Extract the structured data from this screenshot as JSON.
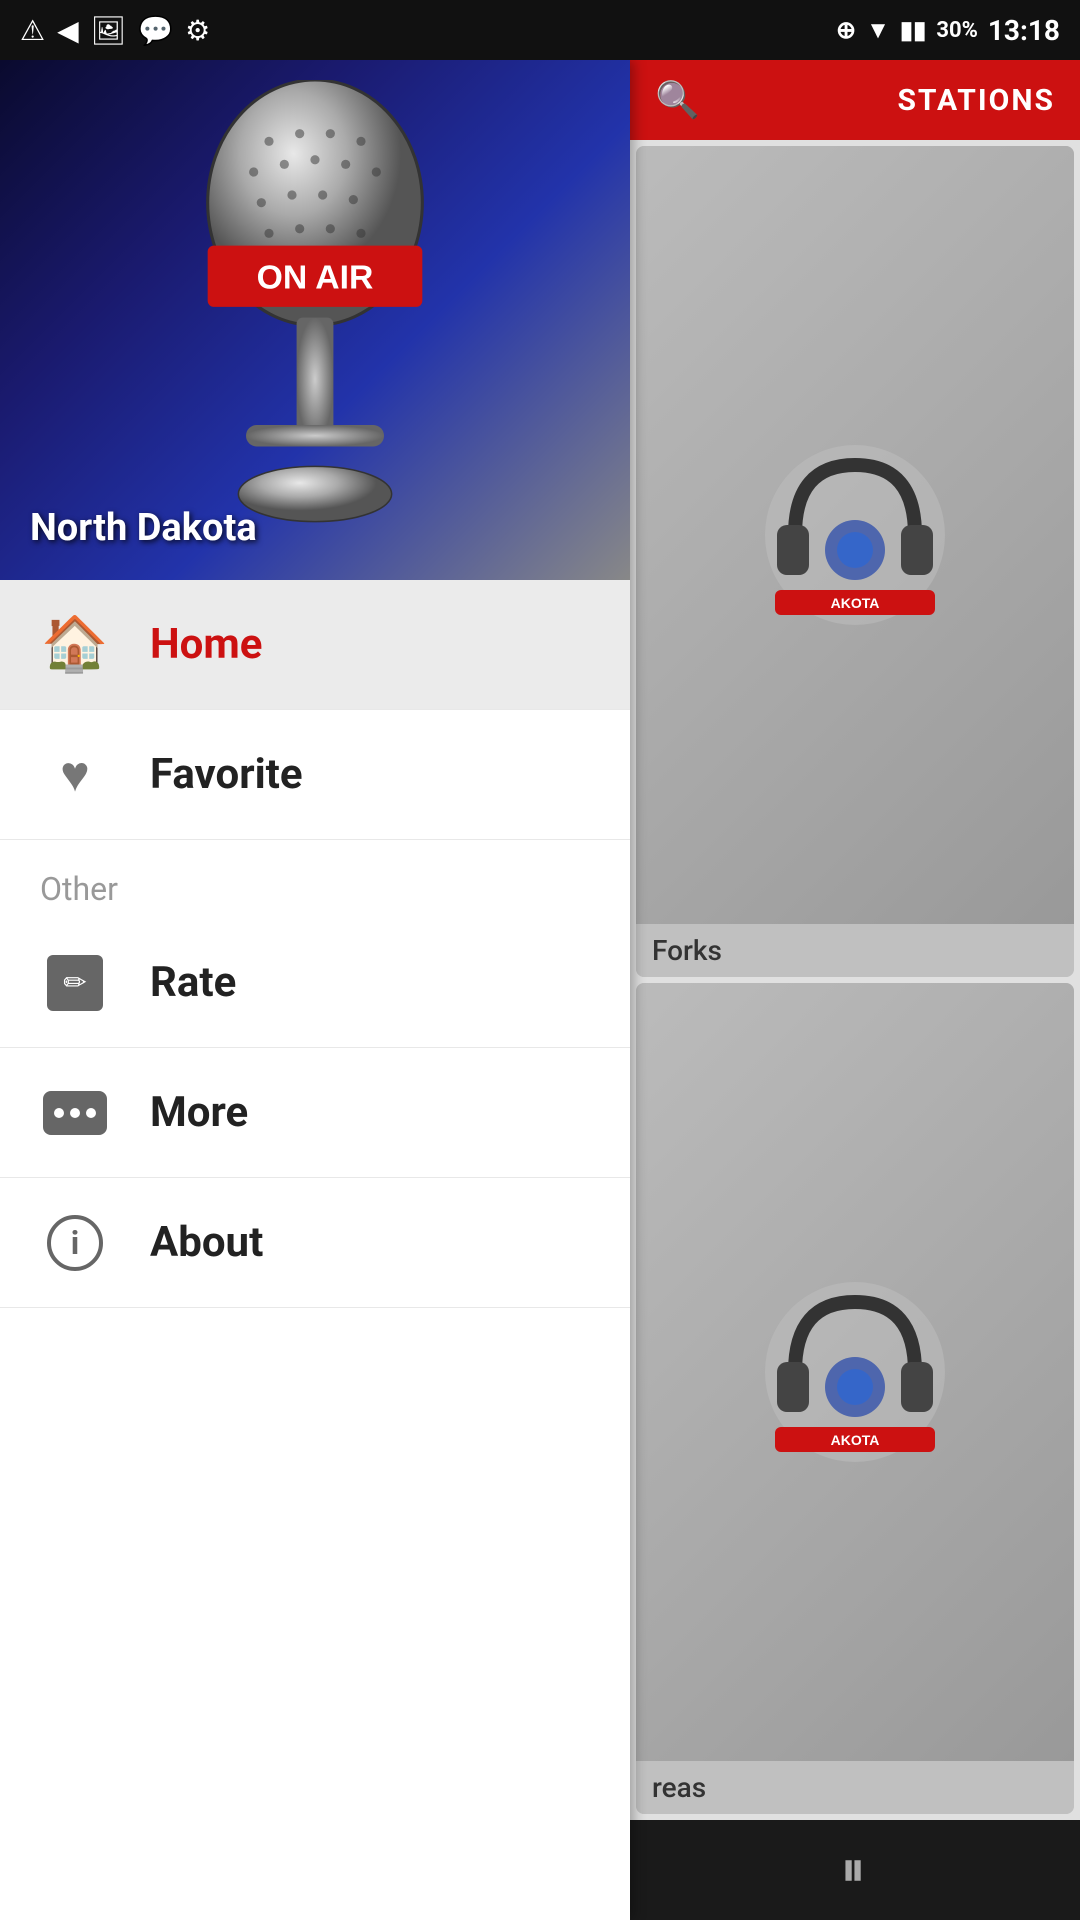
{
  "statusBar": {
    "time": "13:18",
    "battery": "30%"
  },
  "hero": {
    "location": "North Dakota"
  },
  "sidebar": {
    "menuItems": [
      {
        "id": "home",
        "label": "Home",
        "active": true,
        "icon": "home-icon"
      },
      {
        "id": "favorite",
        "label": "Favorite",
        "active": false,
        "icon": "heart-icon"
      }
    ],
    "sectionHeader": "Other",
    "otherItems": [
      {
        "id": "rate",
        "label": "Rate",
        "icon": "rate-icon"
      },
      {
        "id": "more",
        "label": "More",
        "icon": "more-icon"
      },
      {
        "id": "about",
        "label": "About",
        "icon": "about-icon"
      }
    ]
  },
  "rightPanel": {
    "headerLabel": "STATIONS",
    "stations": [
      {
        "id": 1,
        "brandLabel": "AKOTA",
        "locationLabel": "Forks"
      },
      {
        "id": 2,
        "brandLabel": "AKOTA",
        "locationLabel": "reas"
      }
    ]
  }
}
